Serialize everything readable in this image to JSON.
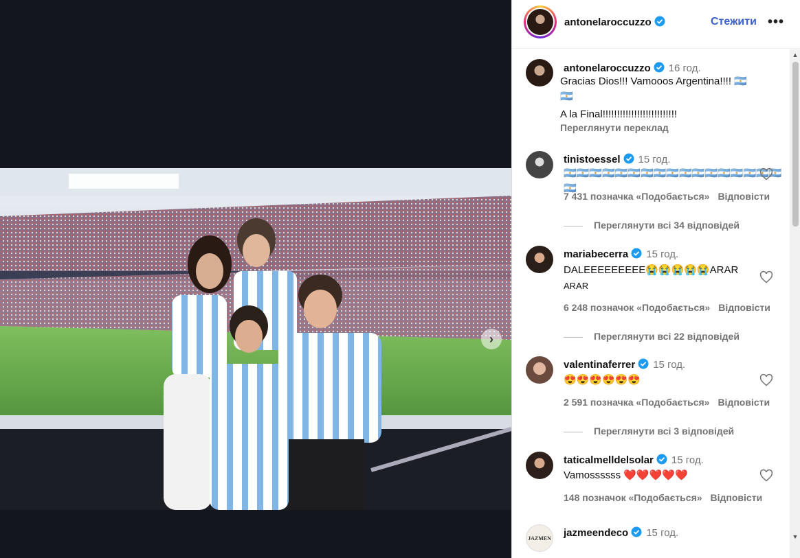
{
  "post": {
    "author": "antonelaroccuzzo",
    "follow_label": "Стежити",
    "more_label": "•••",
    "next_label": "›"
  },
  "caption": {
    "username": "antonelaroccuzzo",
    "time": "16 год.",
    "line1": "Gracias Dios!!! Vamooos Argentina!!!! 🇦🇷",
    "line2": "🇦🇷",
    "line3": "A la Final!!!!!!!!!!!!!!!!!!!!!!!!!!",
    "translate_label": "Переглянути переклад"
  },
  "comments": [
    {
      "username": "tinistoessel",
      "time": "15 год.",
      "text": "🇦🇷🇦🇷🇦🇷🇦🇷🇦🇷🇦🇷🇦🇷🇦🇷🇦🇷🇦🇷🇦🇷🇦🇷🇦🇷🇦🇷🇦🇷🇦🇷🇦🇷🇦🇷",
      "likes": "7 431 позначка «Подобається»",
      "reply_label": "Відповісти",
      "view_replies": "Переглянути всі 34 відповідей"
    },
    {
      "username": "mariabecerra",
      "time": "15 год.",
      "text": "DALEEEEEEEEE😭😭😭😭😭ARAR",
      "text2": "ARAR",
      "likes": "6 248 позначок «Подобається»",
      "reply_label": "Відповісти",
      "view_replies": "Переглянути всі 22 відповідей"
    },
    {
      "username": "valentinaferrer",
      "time": "15 год.",
      "text": "😍😍😍😍😍😍",
      "likes": "2 591 позначка «Подобається»",
      "reply_label": "Відповісти",
      "view_replies": "Переглянути всі 3 відповідей"
    },
    {
      "username": "taticalmelldelsolar",
      "time": "15 год.",
      "text": "Vamossssss ❤️❤️❤️❤️❤️",
      "likes": "148 позначок «Подобається»",
      "reply_label": "Відповісти"
    },
    {
      "username": "jazmeendeco",
      "time": "15 год.",
      "avatar_text": "JAZMEN"
    }
  ],
  "colors": {
    "accent": "#3a5fcd",
    "verified": "#1d9bf0",
    "muted": "#737373"
  }
}
